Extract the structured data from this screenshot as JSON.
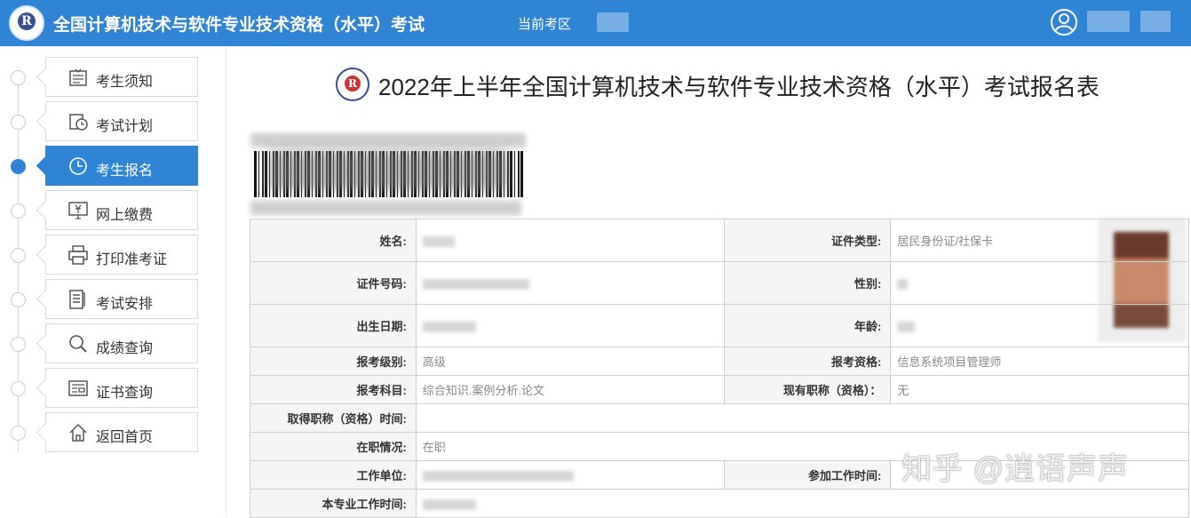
{
  "header": {
    "app_title": "全国计算机技术与软件专业技术资格（水平）考试",
    "region_label": "当前考区"
  },
  "sidebar": {
    "items": [
      {
        "label": "考生须知",
        "icon": "notice-icon",
        "active": false
      },
      {
        "label": "考试计划",
        "icon": "calendar-icon",
        "active": false
      },
      {
        "label": "考生报名",
        "icon": "clock-icon",
        "active": true
      },
      {
        "label": "网上缴费",
        "icon": "payment-icon",
        "active": false
      },
      {
        "label": "打印准考证",
        "icon": "printer-icon",
        "active": false
      },
      {
        "label": "考试安排",
        "icon": "document-icon",
        "active": false
      },
      {
        "label": "成绩查询",
        "icon": "search-icon",
        "active": false
      },
      {
        "label": "证书查询",
        "icon": "certificate-icon",
        "active": false
      },
      {
        "label": "返回首页",
        "icon": "home-icon",
        "active": false
      }
    ]
  },
  "main": {
    "title": "2022年上半年全国计算机技术与软件专业技术资格（水平）考试报名表",
    "form": {
      "name_label": "姓名:",
      "id_type_label": "证件类型:",
      "id_type_value": "居民身份证/社保卡",
      "id_number_label": "证件号码:",
      "gender_label": "性别:",
      "birth_label": "出生日期:",
      "age_label": "年龄:",
      "level_label": "报考级别:",
      "level_value": "高级",
      "qualification_label": "报考资格:",
      "qualification_value": "信息系统项目管理师",
      "subjects_label": "报考科目:",
      "subjects_value": "综合知识.案例分析.论文",
      "title_label": "现有职称（资格）：",
      "title_value": "无",
      "title_time_label": "取得职称（资格）时间:",
      "employment_label": "在职情况:",
      "employment_value": "在职",
      "employer_label": "工作单位:",
      "work_start_label": "参加工作时间:",
      "major_years_label": "本专业工作时间:"
    }
  },
  "watermark": "知乎 @逍语声声",
  "colors": {
    "accent": "#2f84d6"
  }
}
